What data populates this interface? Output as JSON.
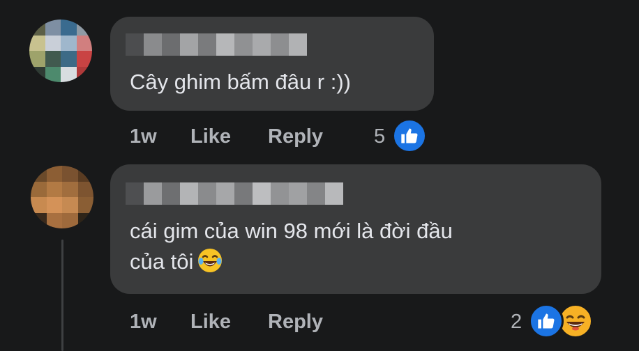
{
  "comments": [
    {
      "text": "Cây ghim bấm đâu r :))",
      "time": "1w",
      "like_label": "Like",
      "reply_label": "Reply",
      "reaction_count": "5",
      "reactions": [
        "like-icon"
      ]
    },
    {
      "text": "cái gim của win 98 mới là đời đầu\ncủa tôi",
      "inline_emoji": "laughing-tears-emoji",
      "time": "1w",
      "like_label": "Like",
      "reply_label": "Reply",
      "reaction_count": "2",
      "reactions": [
        "like-icon",
        "haha-icon"
      ]
    }
  ],
  "colors": {
    "background": "#18191a",
    "bubble": "#3a3b3c",
    "text": "#e4e6eb",
    "secondary_text": "#b0b3b8",
    "like_blue": "#1b74e4",
    "haha_yellow": "#f7b125"
  }
}
